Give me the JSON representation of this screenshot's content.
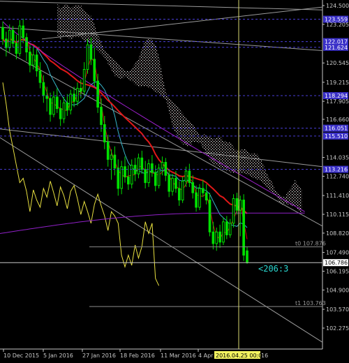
{
  "chart_data": {
    "type": "candlestick",
    "y_range": [
      102.275,
      124.5
    ],
    "grid": false,
    "y_ticks": [
      124.5,
      123.205,
      120.545,
      119.215,
      117.905,
      116.66,
      114.035,
      112.74,
      111.41,
      110.115,
      108.82,
      107.49,
      106.195,
      104.9,
      103.57,
      102.275
    ],
    "y_tick_labels": [
      "124.500",
      "123.205",
      "120.545",
      "119.215",
      "117.905",
      "116.660",
      "114.035",
      "112.740",
      "111.410",
      "110.115",
      "108.820",
      "107.490",
      "106.195",
      "104.900",
      "103.570",
      "102.275"
    ],
    "x_tick_labels": [
      "10 Dec 2015",
      "5 Jan 2016",
      "27 Jan 2016",
      "18 Feb 2016",
      "11 Mar 2016",
      "4 Apr 2016"
    ],
    "cursor_time_label": "2016.04.25 00:00",
    "cursor_time_suffix": "16",
    "levels": [
      {
        "price": 123.559,
        "label": "123.559",
        "bg": "#3a30c8",
        "fg": "#ffffff"
      },
      {
        "price": 122.017,
        "label": "122.017",
        "bg": "#3a30c8",
        "fg": "#ffffff"
      },
      {
        "price": 121.624,
        "label": "121.624",
        "bg": "#3a30c8",
        "fg": "#ffffff"
      },
      {
        "price": 118.294,
        "label": "118.294",
        "bg": "#3a30c8",
        "fg": "#ffffff"
      },
      {
        "price": 116.051,
        "label": "116.051",
        "bg": "#3a30c8",
        "fg": "#ffffff"
      },
      {
        "price": 115.51,
        "label": "115.510",
        "bg": "#3a30c8",
        "fg": "#ffffff"
      },
      {
        "price": 113.216,
        "label": "113.216",
        "bg": "#3a30c8",
        "fg": "#ffffff"
      },
      {
        "price": 106.786,
        "label": "106.786",
        "bg": "#ffffff",
        "fg": "#000000"
      }
    ],
    "annotations": {
      "t0_label": "t0 107.876",
      "t1_label": "t1 103.763",
      "countdown": "<206:3"
    },
    "candles": [
      {
        "o": 123.0,
        "h": 123.4,
        "l": 121.8,
        "c": 122.2
      },
      {
        "o": 122.2,
        "h": 122.7,
        "l": 121.0,
        "c": 121.6
      },
      {
        "o": 121.6,
        "h": 123.2,
        "l": 121.3,
        "c": 122.8
      },
      {
        "o": 122.8,
        "h": 123.1,
        "l": 121.6,
        "c": 121.9
      },
      {
        "o": 121.9,
        "h": 122.5,
        "l": 120.8,
        "c": 121.2
      },
      {
        "o": 121.2,
        "h": 123.5,
        "l": 121.0,
        "c": 123.1
      },
      {
        "o": 123.1,
        "h": 123.6,
        "l": 121.9,
        "c": 122.3
      },
      {
        "o": 122.3,
        "h": 122.6,
        "l": 120.7,
        "c": 121.3
      },
      {
        "o": 121.3,
        "h": 121.8,
        "l": 119.9,
        "c": 120.4
      },
      {
        "o": 120.4,
        "h": 121.7,
        "l": 120.1,
        "c": 121.1
      },
      {
        "o": 121.1,
        "h": 121.5,
        "l": 119.6,
        "c": 120.0
      },
      {
        "o": 120.0,
        "h": 120.6,
        "l": 118.8,
        "c": 119.2
      },
      {
        "o": 119.2,
        "h": 119.7,
        "l": 117.8,
        "c": 118.3
      },
      {
        "o": 118.3,
        "h": 118.9,
        "l": 117.2,
        "c": 118.1
      },
      {
        "o": 118.1,
        "h": 118.5,
        "l": 116.5,
        "c": 117.0
      },
      {
        "o": 117.0,
        "h": 118.6,
        "l": 116.8,
        "c": 118.2
      },
      {
        "o": 118.2,
        "h": 118.8,
        "l": 117.1,
        "c": 117.4
      },
      {
        "o": 117.4,
        "h": 118.0,
        "l": 116.2,
        "c": 116.7
      },
      {
        "o": 116.7,
        "h": 118.2,
        "l": 116.4,
        "c": 117.8
      },
      {
        "o": 117.8,
        "h": 118.4,
        "l": 116.9,
        "c": 117.3
      },
      {
        "o": 117.3,
        "h": 118.7,
        "l": 117.0,
        "c": 118.4
      },
      {
        "o": 118.4,
        "h": 118.9,
        "l": 117.5,
        "c": 117.9
      },
      {
        "o": 117.9,
        "h": 119.2,
        "l": 117.6,
        "c": 118.8
      },
      {
        "o": 118.8,
        "h": 119.4,
        "l": 118.1,
        "c": 118.6
      },
      {
        "o": 118.6,
        "h": 120.6,
        "l": 118.3,
        "c": 120.1
      },
      {
        "o": 120.1,
        "h": 122.2,
        "l": 119.8,
        "c": 121.8
      },
      {
        "o": 121.8,
        "h": 122.3,
        "l": 120.4,
        "c": 120.8
      },
      {
        "o": 120.8,
        "h": 121.6,
        "l": 118.9,
        "c": 119.3
      },
      {
        "o": 119.3,
        "h": 119.8,
        "l": 117.1,
        "c": 117.5
      },
      {
        "o": 117.5,
        "h": 118.1,
        "l": 115.8,
        "c": 116.3
      },
      {
        "o": 116.3,
        "h": 116.9,
        "l": 114.6,
        "c": 115.1
      },
      {
        "o": 115.1,
        "h": 115.6,
        "l": 113.4,
        "c": 113.9
      },
      {
        "o": 113.9,
        "h": 114.6,
        "l": 112.5,
        "c": 114.2
      },
      {
        "o": 114.2,
        "h": 114.8,
        "l": 112.8,
        "c": 113.3
      },
      {
        "o": 113.3,
        "h": 113.9,
        "l": 111.4,
        "c": 111.9
      },
      {
        "o": 111.9,
        "h": 113.8,
        "l": 111.5,
        "c": 113.4
      },
      {
        "o": 113.4,
        "h": 114.1,
        "l": 112.3,
        "c": 112.7
      },
      {
        "o": 112.7,
        "h": 113.5,
        "l": 111.8,
        "c": 112.2
      },
      {
        "o": 112.2,
        "h": 113.9,
        "l": 111.9,
        "c": 113.5
      },
      {
        "o": 113.5,
        "h": 114.0,
        "l": 112.4,
        "c": 112.9
      },
      {
        "o": 112.9,
        "h": 114.3,
        "l": 112.6,
        "c": 114.0
      },
      {
        "o": 114.0,
        "h": 114.5,
        "l": 112.9,
        "c": 113.2
      },
      {
        "o": 113.2,
        "h": 113.8,
        "l": 111.9,
        "c": 112.3
      },
      {
        "o": 112.3,
        "h": 113.9,
        "l": 112.0,
        "c": 113.6
      },
      {
        "o": 113.6,
        "h": 114.2,
        "l": 112.7,
        "c": 113.0
      },
      {
        "o": 113.0,
        "h": 113.5,
        "l": 111.7,
        "c": 112.1
      },
      {
        "o": 112.1,
        "h": 113.6,
        "l": 111.9,
        "c": 113.3
      },
      {
        "o": 113.3,
        "h": 114.1,
        "l": 112.8,
        "c": 113.7
      },
      {
        "o": 113.7,
        "h": 114.0,
        "l": 112.4,
        "c": 112.8
      },
      {
        "o": 112.8,
        "h": 113.2,
        "l": 111.3,
        "c": 111.7
      },
      {
        "o": 111.7,
        "h": 112.9,
        "l": 111.4,
        "c": 112.6
      },
      {
        "o": 112.6,
        "h": 113.1,
        "l": 111.6,
        "c": 111.9
      },
      {
        "o": 111.9,
        "h": 112.4,
        "l": 110.7,
        "c": 111.1
      },
      {
        "o": 111.1,
        "h": 112.7,
        "l": 110.9,
        "c": 112.4
      },
      {
        "o": 112.4,
        "h": 113.4,
        "l": 112.0,
        "c": 113.1
      },
      {
        "o": 113.1,
        "h": 113.6,
        "l": 112.0,
        "c": 112.3
      },
      {
        "o": 112.3,
        "h": 112.8,
        "l": 111.2,
        "c": 111.6
      },
      {
        "o": 111.6,
        "h": 112.1,
        "l": 110.3,
        "c": 110.6
      },
      {
        "o": 110.6,
        "h": 112.2,
        "l": 110.4,
        "c": 111.9
      },
      {
        "o": 111.9,
        "h": 112.5,
        "l": 111.3,
        "c": 111.6
      },
      {
        "o": 111.6,
        "h": 112.2,
        "l": 110.8,
        "c": 111.1
      },
      {
        "o": 111.1,
        "h": 111.6,
        "l": 108.6,
        "c": 108.9
      },
      {
        "o": 108.9,
        "h": 109.6,
        "l": 107.7,
        "c": 108.1
      },
      {
        "o": 108.1,
        "h": 109.2,
        "l": 107.6,
        "c": 108.9
      },
      {
        "o": 108.9,
        "h": 109.4,
        "l": 107.8,
        "c": 108.2
      },
      {
        "o": 108.2,
        "h": 109.9,
        "l": 108.0,
        "c": 109.6
      },
      {
        "o": 109.6,
        "h": 110.0,
        "l": 108.4,
        "c": 108.7
      },
      {
        "o": 108.7,
        "h": 109.8,
        "l": 108.5,
        "c": 109.5
      },
      {
        "o": 109.5,
        "h": 111.5,
        "l": 109.2,
        "c": 111.2
      },
      {
        "o": 111.2,
        "h": 111.6,
        "l": 110.1,
        "c": 110.4
      },
      {
        "o": 110.4,
        "h": 111.4,
        "l": 108.6,
        "c": 111.1
      },
      {
        "o": 111.1,
        "h": 111.5,
        "l": 106.9,
        "c": 107.3
      },
      {
        "o": 107.6,
        "h": 107.9,
        "l": 106.7,
        "c": 106.8
      }
    ]
  }
}
